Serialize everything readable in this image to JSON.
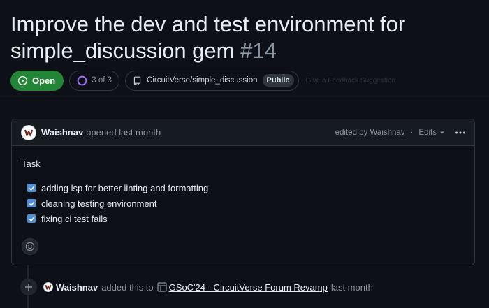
{
  "issue": {
    "title": "Improve the dev and test environment for simple_discussion gem",
    "number": "#14",
    "state": "Open",
    "progress": "3 of 3",
    "progress_fraction": 1.0,
    "repository": "CircuitVerse/simple_discussion",
    "visibility": "Public",
    "faded_label": "Give a Feedback Suggestion"
  },
  "comment": {
    "author": "Waishnav",
    "action": "opened last month",
    "edited_by": "edited by Waishnav",
    "edits_label": "Edits",
    "body_title": "Task",
    "tasks": [
      {
        "label": "adding lsp for better linting and formatting",
        "checked": true
      },
      {
        "label": "cleaning testing environment",
        "checked": true
      },
      {
        "label": "fixing ci test fails",
        "checked": true
      }
    ]
  },
  "timeline": {
    "author": "Waishnav",
    "action": "added this to",
    "project": "GSoC'24 - CircuitVerse Forum Revamp",
    "time": "last month"
  },
  "colors": {
    "background": "#0d1117",
    "open_badge": "#238636",
    "checkbox": "#4f8fd8",
    "border": "#30363d",
    "muted_text": "#8b949e"
  },
  "icons": {
    "state": "issue-open-icon",
    "progress": "progress-ring-icon",
    "repo": "repo-icon",
    "avatar": "user-avatar",
    "menu": "kebab-horizontal-icon",
    "reaction": "smiley-icon",
    "timeline": "plus-icon",
    "project": "table-icon"
  }
}
